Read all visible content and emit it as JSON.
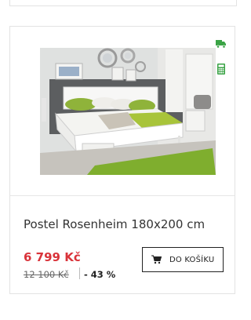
{
  "product": {
    "name": "Postel Rosenheim 180x200 cm",
    "price": "6 799 Kč",
    "old_price": "12 100 Kč",
    "discount": "- 43 %",
    "add_to_cart_label": "DO KOŠÍKU",
    "image_alt": "Postel Rosenheim"
  },
  "icons": {
    "delivery": "truck-icon",
    "installment": "calculator-icon",
    "cart": "shopping-cart-icon"
  },
  "colors": {
    "price": "#d9333a",
    "icon_green": "#3aa345",
    "border": "#e3e3e3",
    "text": "#333333"
  }
}
